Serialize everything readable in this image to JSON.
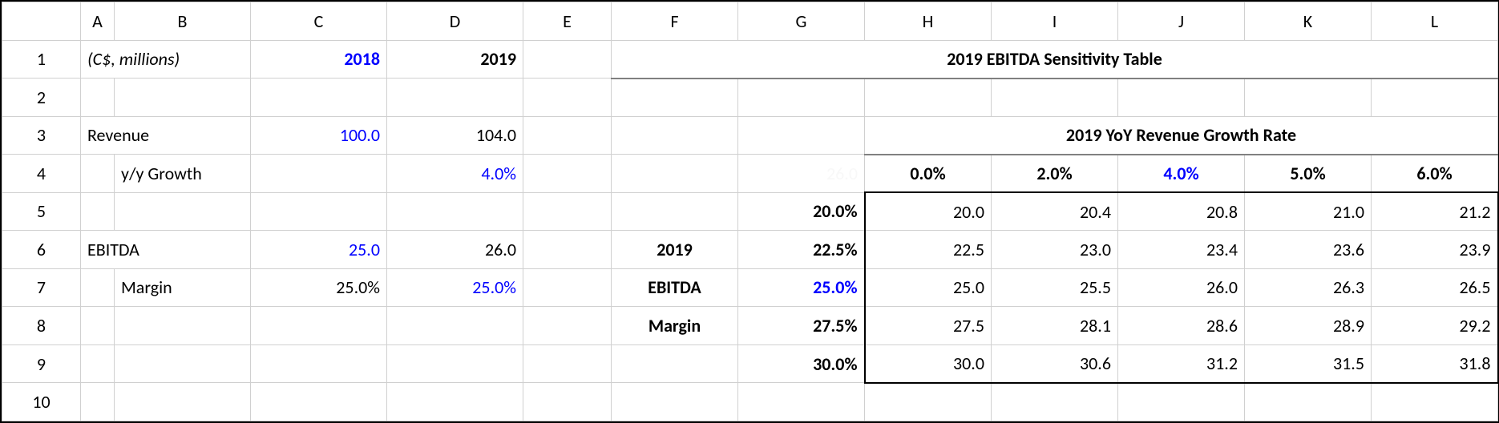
{
  "columns": [
    "A",
    "B",
    "C",
    "D",
    "E",
    "F",
    "G",
    "H",
    "I",
    "J",
    "K",
    "L"
  ],
  "rows": [
    "1",
    "2",
    "3",
    "4",
    "5",
    "6",
    "7",
    "8",
    "9",
    "10"
  ],
  "units_label": "(C$, millions)",
  "years": {
    "y2018": "2018",
    "y2019": "2019"
  },
  "sens_title": "2019 EBITDA Sensitivity Table",
  "rev_label": "Revenue",
  "rev_2018": "100.0",
  "rev_2019": "104.0",
  "growth_subtitle": "2019 YoY Revenue Growth Rate",
  "yy_label": "y/y Growth",
  "yy_2019": "4.0%",
  "faint_g4": "26.0",
  "growth_headers": [
    "0.0%",
    "2.0%",
    "4.0%",
    "5.0%",
    "6.0%"
  ],
  "ebitda_label": "EBITDA",
  "ebitda_2018": "25.0",
  "ebitda_2019": "26.0",
  "f_2019": "2019",
  "f_ebitda": "EBITDA",
  "f_margin": "Margin",
  "margin_label": "Margin",
  "margin_2018": "25.0%",
  "margin_2019": "25.0%",
  "margin_rows": [
    "20.0%",
    "22.5%",
    "25.0%",
    "27.5%",
    "30.0%"
  ],
  "sens": {
    "r5": [
      "20.0",
      "20.4",
      "20.8",
      "21.0",
      "21.2"
    ],
    "r6": [
      "22.5",
      "23.0",
      "23.4",
      "23.6",
      "23.9"
    ],
    "r7": [
      "25.0",
      "25.5",
      "26.0",
      "26.3",
      "26.5"
    ],
    "r8": [
      "27.5",
      "28.1",
      "28.6",
      "28.9",
      "29.2"
    ],
    "r9": [
      "30.0",
      "30.6",
      "31.2",
      "31.5",
      "31.8"
    ]
  },
  "chart_data": {
    "type": "table",
    "title": "2019 EBITDA Sensitivity Table",
    "x_axis": {
      "label": "2019 YoY Revenue Growth Rate",
      "values": [
        "0.0%",
        "2.0%",
        "4.0%",
        "5.0%",
        "6.0%"
      ]
    },
    "y_axis": {
      "label": "2019 EBITDA Margin",
      "values": [
        "20.0%",
        "22.5%",
        "25.0%",
        "27.5%",
        "30.0%"
      ]
    },
    "data": [
      [
        20.0,
        20.4,
        20.8,
        21.0,
        21.2
      ],
      [
        22.5,
        23.0,
        23.4,
        23.6,
        23.9
      ],
      [
        25.0,
        25.5,
        26.0,
        26.3,
        26.5
      ],
      [
        27.5,
        28.1,
        28.6,
        28.9,
        29.2
      ],
      [
        30.0,
        30.6,
        31.2,
        31.5,
        31.8
      ]
    ],
    "inputs": {
      "revenue_2018": 100.0,
      "revenue_2019": 104.0,
      "yoy_growth_2019": 0.04,
      "ebitda_2018": 25.0,
      "ebitda_2019": 26.0,
      "ebitda_margin_2018": 0.25,
      "ebitda_margin_2019": 0.25
    }
  }
}
